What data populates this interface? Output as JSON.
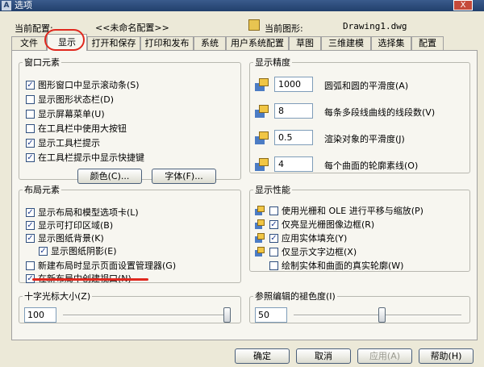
{
  "window": {
    "title": "选项",
    "close_label": "X"
  },
  "config": {
    "current_profile_label": "当前配置:",
    "current_profile_value": "<<未命名配置>>",
    "current_drawing_label": "当前图形:",
    "current_drawing_value": "Drawing1.dwg"
  },
  "tabs": [
    "文件",
    "显示",
    "打开和保存",
    "打印和发布",
    "系统",
    "用户系统配置",
    "草图",
    "三维建模",
    "选择集",
    "配置"
  ],
  "active_tab": "显示",
  "window_elements": {
    "title": "窗口元素",
    "items": [
      {
        "label": "图形窗口中显示滚动条(S)",
        "checked": true
      },
      {
        "label": "显示图形状态栏(D)",
        "checked": false
      },
      {
        "label": "显示屏幕菜单(U)",
        "checked": false
      },
      {
        "label": "在工具栏中使用大按钮",
        "checked": false
      },
      {
        "label": "显示工具栏提示",
        "checked": true
      },
      {
        "label": "在工具栏提示中显示快捷键",
        "checked": true
      }
    ],
    "colors_button": "颜色(C)...",
    "fonts_button": "字体(F)..."
  },
  "layout_elements": {
    "title": "布局元素",
    "items": [
      {
        "label": "显示布局和模型选项卡(L)",
        "checked": true
      },
      {
        "label": "显示可打印区域(B)",
        "checked": true
      },
      {
        "label": "显示图纸背景(K)",
        "checked": true
      },
      {
        "label": "显示图纸阴影(E)",
        "checked": true
      },
      {
        "label": "新建布局时显示页面设置管理器(G)",
        "checked": false
      },
      {
        "label": "在新布局中创建视口(N)",
        "checked": true
      }
    ]
  },
  "display_resolution": {
    "title": "显示精度",
    "items": [
      {
        "value": "1000",
        "label": "圆弧和圆的平滑度(A)"
      },
      {
        "value": "8",
        "label": "每条多段线曲线的线段数(V)"
      },
      {
        "value": "0.5",
        "label": "渲染对象的平滑度(J)"
      },
      {
        "value": "4",
        "label": "每个曲面的轮廓素线(O)"
      }
    ]
  },
  "display_performance": {
    "title": "显示性能",
    "items": [
      {
        "label": "使用光栅和 OLE 进行平移与缩放(P)",
        "checked": false,
        "icon": true
      },
      {
        "label": "仅亮显光栅图像边框(R)",
        "checked": true,
        "icon": true
      },
      {
        "label": "应用实体填充(Y)",
        "checked": true,
        "icon": true
      },
      {
        "label": "仅显示文字边框(X)",
        "checked": false,
        "icon": true
      },
      {
        "label": "绘制实体和曲面的真实轮廓(W)",
        "checked": false,
        "icon": false
      }
    ]
  },
  "crosshair": {
    "title": "十字光标大小(Z)",
    "value": "100",
    "level_percent": 100
  },
  "xref_fade": {
    "title": "参照编辑的褪色度(I)",
    "value": "50",
    "level_percent": 50
  },
  "footer": {
    "ok": "确定",
    "cancel": "取消",
    "apply": "应用(A)",
    "help": "帮助(H)"
  },
  "colors": {
    "annotation_red": "#e0281e",
    "title_bar": "#2b4a78"
  }
}
